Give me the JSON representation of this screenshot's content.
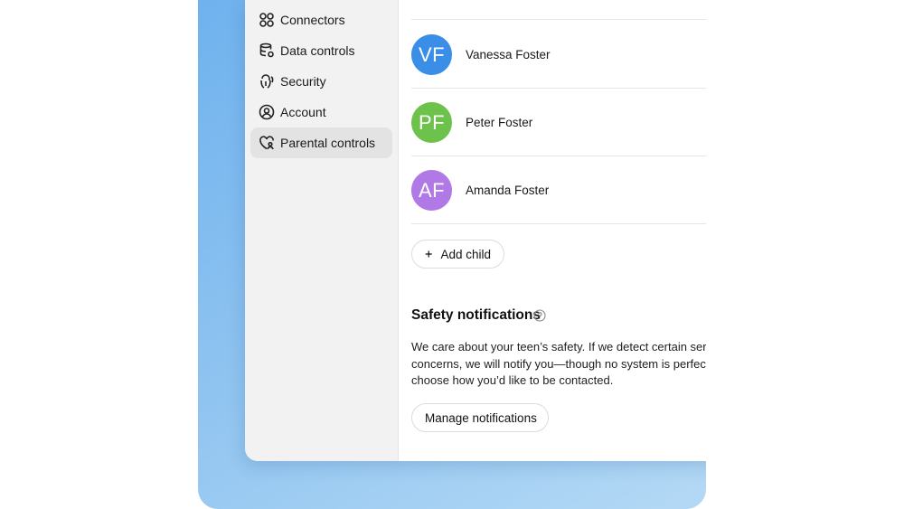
{
  "sidebar": {
    "items": [
      {
        "label": "Connectors",
        "icon": "connectors-icon",
        "active": false
      },
      {
        "label": "Data controls",
        "icon": "data-controls-icon",
        "active": false
      },
      {
        "label": "Security",
        "icon": "security-icon",
        "active": false
      },
      {
        "label": "Account",
        "icon": "account-icon",
        "active": false
      },
      {
        "label": "Parental controls",
        "icon": "parental-controls-icon",
        "active": true
      }
    ]
  },
  "children": [
    {
      "initials": "VF",
      "name": "Vanessa Foster",
      "color": "#3a8ee8"
    },
    {
      "initials": "PF",
      "name": "Peter Foster",
      "color": "#6cc24a"
    },
    {
      "initials": "AF",
      "name": "Amanda Foster",
      "color": "#b079e6"
    }
  ],
  "add_child": {
    "icon": "plus-icon",
    "label": "Add child"
  },
  "safety": {
    "title": "Safety notifications",
    "help_icon": "help-circle-icon",
    "description_lines": [
      "We care about your teen’s safety. If we detect certain seriou",
      "concerns, we will notify you—though no system is perfect. Y",
      "choose how you’d like to be contacted."
    ],
    "manage_button": "Manage notifications"
  },
  "colors": {
    "backdrop_start": "#6fb2ee",
    "backdrop_end": "#b4d9f5",
    "sidebar_bg": "#f2f2f2",
    "active_item_bg": "#e3e3e3"
  }
}
